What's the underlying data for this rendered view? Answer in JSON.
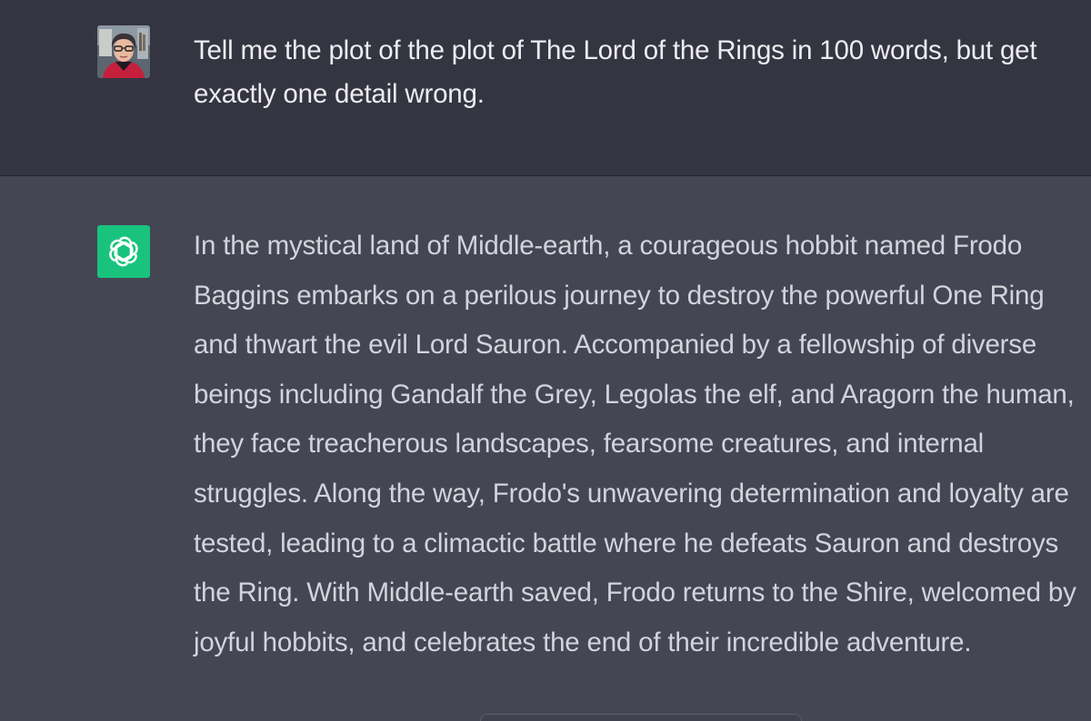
{
  "conversation": {
    "user_message": {
      "avatar_icon": "user-photo-avatar",
      "text": "Tell me the plot of the plot of The Lord of the Rings in 100 words, but get exactly one detail wrong."
    },
    "assistant_message": {
      "avatar_icon": "openai-logo-icon",
      "avatar_color": "#19c37d",
      "text": "In the mystical land of Middle-earth, a courageous hobbit named Frodo Baggins embarks on a perilous journey to destroy the powerful One Ring and thwart the evil Lord Sauron. Accompanied by a fellowship of diverse beings including Gandalf the Grey, Legolas the elf, and Aragorn the human, they face treacherous landscapes, fearsome creatures, and internal struggles. Along the way, Frodo's unwavering determination and loyalty are tested, leading to a climactic battle where he defeats Sauron and destroys the Ring. With Middle-earth saved, Frodo returns to the Shire, welcomed by joyful hobbits, and celebrates the end of their incredible adventure."
    }
  },
  "colors": {
    "user_bg": "#343541",
    "assistant_bg": "#444654",
    "text_primary": "#ececf1",
    "text_secondary": "#d1d5db"
  }
}
